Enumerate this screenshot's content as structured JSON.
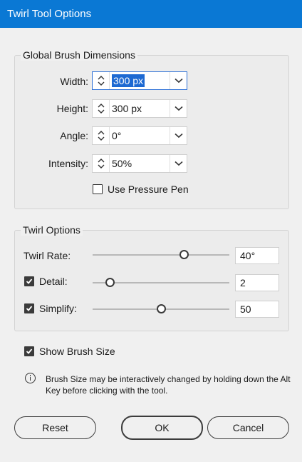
{
  "dialog": {
    "title": "Twirl Tool Options"
  },
  "brush": {
    "group_label": "Global Brush Dimensions",
    "width": {
      "label": "Width:",
      "value": "300 px"
    },
    "height": {
      "label": "Height:",
      "value": "300 px"
    },
    "angle": {
      "label": "Angle:",
      "value": "0°"
    },
    "intensity": {
      "label": "Intensity:",
      "value": "50%"
    },
    "pressure_pen": {
      "label": "Use Pressure Pen",
      "checked": false
    }
  },
  "twirl": {
    "group_label": "Twirl Options",
    "rate": {
      "label": "Twirl Rate:",
      "value": "40°",
      "slider_fraction": 0.67
    },
    "detail": {
      "label": "Detail:",
      "value": "2",
      "checked": true,
      "slider_fraction": 0.13
    },
    "simplify": {
      "label": "Simplify:",
      "value": "50",
      "checked": true,
      "slider_fraction": 0.5
    }
  },
  "show_brush_size": {
    "label": "Show Brush Size",
    "checked": true
  },
  "info": {
    "icon": "info-icon",
    "text": "Brush Size may be interactively changed by holding down the Alt Key before clicking with the tool."
  },
  "buttons": {
    "reset": "Reset",
    "ok": "OK",
    "cancel": "Cancel"
  },
  "colors": {
    "titlebar": "#0a78d4",
    "selection": "#1d69d2",
    "focus_border": "#2b6fd6"
  }
}
